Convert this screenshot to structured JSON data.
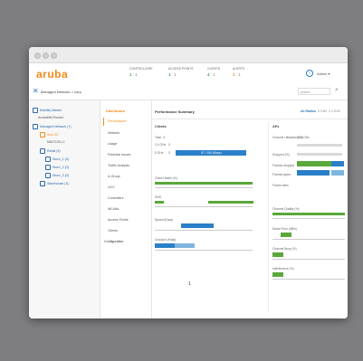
{
  "app": {
    "logo": "aruba"
  },
  "header": {
    "stats": [
      {
        "label": "CONTROLLERS",
        "value": "1",
        "status": "1"
      },
      {
        "label": "ACCESS POINTS",
        "value": "1",
        "status": "1"
      },
      {
        "label": "CLIENTS",
        "value": "4",
        "status": "1"
      },
      {
        "label": "ALERTS",
        "value": "1",
        "status": "1"
      }
    ],
    "help_icon": "help-icon",
    "user": "Admin ▾"
  },
  "navbar": {
    "title": "Managed Network > corp",
    "search_placeholder": "search"
  },
  "tree": [
    "Mobility Master",
    "ArubaMM-Pocket",
    "Managed Network (7)",
    "Vmf-C3",
    "MM72151-C",
    "Retail (3)",
    "Store_1 (3)",
    "Store_2 (3)",
    "Store_3 (3)",
    "Warehouse (3)"
  ],
  "menu": {
    "head": "Dashboard",
    "items": [
      "Performance",
      "Network",
      "Usage",
      "Potential Issues",
      "Traffic Analysis",
      "A-Group",
      "UCC",
      "Controllers",
      "WLANs",
      "Access Points",
      "Clients"
    ],
    "config": "Configuration"
  },
  "content": {
    "title": "Performance Summary",
    "ranges": [
      "All Radios",
      "5 GHz",
      "2.4 GHz"
    ],
    "clients": {
      "heading": "Clients",
      "total_label": "Total",
      "total": "3",
      "band_24_label": "2.4 GHz",
      "band_24_value": "0",
      "band_5_label": "5 GHz",
      "band_5_value": "3",
      "band_5_bar": "97 / 100 (Kbps)",
      "client_health": "Client Health (%)",
      "snr": "SNR",
      "speed": "Speed (Kbps)",
      "goodput": "Goodput (Kbps)",
      "dash": "1"
    },
    "aps": {
      "heading": "APs",
      "channel_util": "Channel Utilization (%)",
      "channel_util_val": "All 5 GHz",
      "dropped": "Dropped (%)",
      "frames_dropped": "Frames dropped",
      "frames_types": "Frames types",
      "frame_rates": "Frame rates",
      "channel_quality": "Channel Quality (%)",
      "noise_floor": "Noise Floor (dBm)",
      "channel_busy": "Channel Busy (%)",
      "interference": "Interference (%)"
    }
  }
}
